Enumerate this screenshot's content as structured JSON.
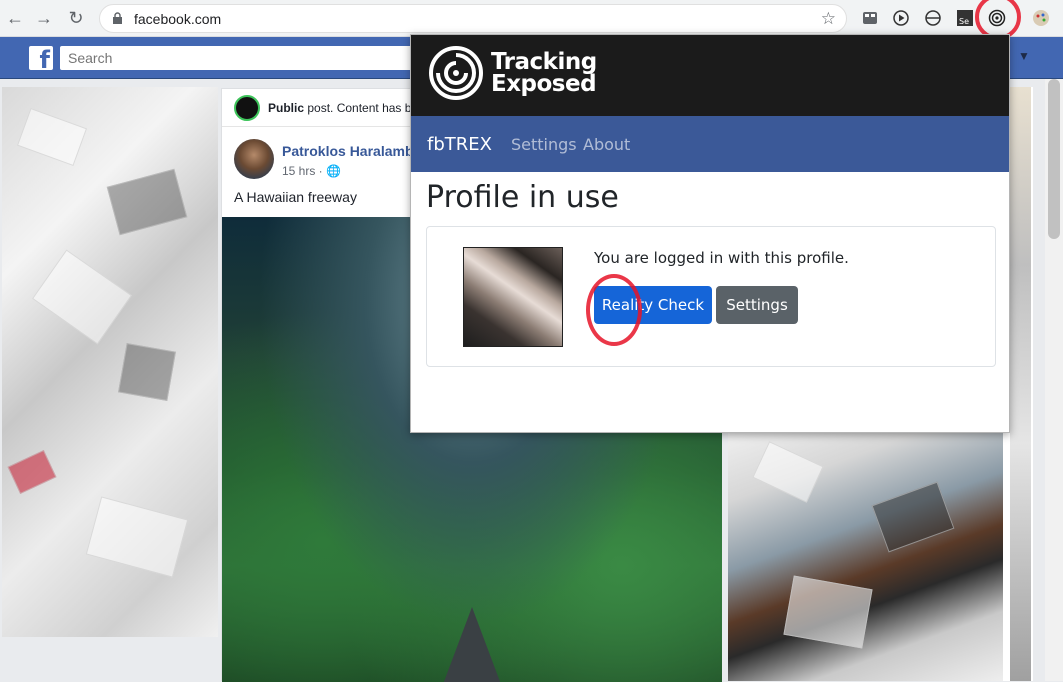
{
  "browser": {
    "url": "facebook.com",
    "back_icon": "arrow-left-icon",
    "forward_icon": "arrow-right-icon",
    "reload_icon": "reload-icon",
    "extensions": [
      "extension-grid-icon",
      "play-icon",
      "circle-icon",
      "selenium-icon",
      "tracking-exposed-icon",
      "palette-icon"
    ]
  },
  "facebook": {
    "logo": "f",
    "search_placeholder": "Search",
    "notice_bold": "Public",
    "notice_rest": " post. Content has b",
    "author": "Patroklos Haralamb",
    "time": "15 hrs · ",
    "post_text": "A Hawaiian freeway",
    "brand_color": "#4267b2"
  },
  "popup": {
    "logo_line1": "Tracking",
    "logo_line2": "Exposed",
    "brand": "fbTREX",
    "nav": [
      "Settings",
      "About"
    ],
    "heading": "Profile in use",
    "card_text": "You are logged in with this profile.",
    "primary_button": "Reality Check",
    "secondary_button": "Settings",
    "nav_color": "#3b5998"
  }
}
